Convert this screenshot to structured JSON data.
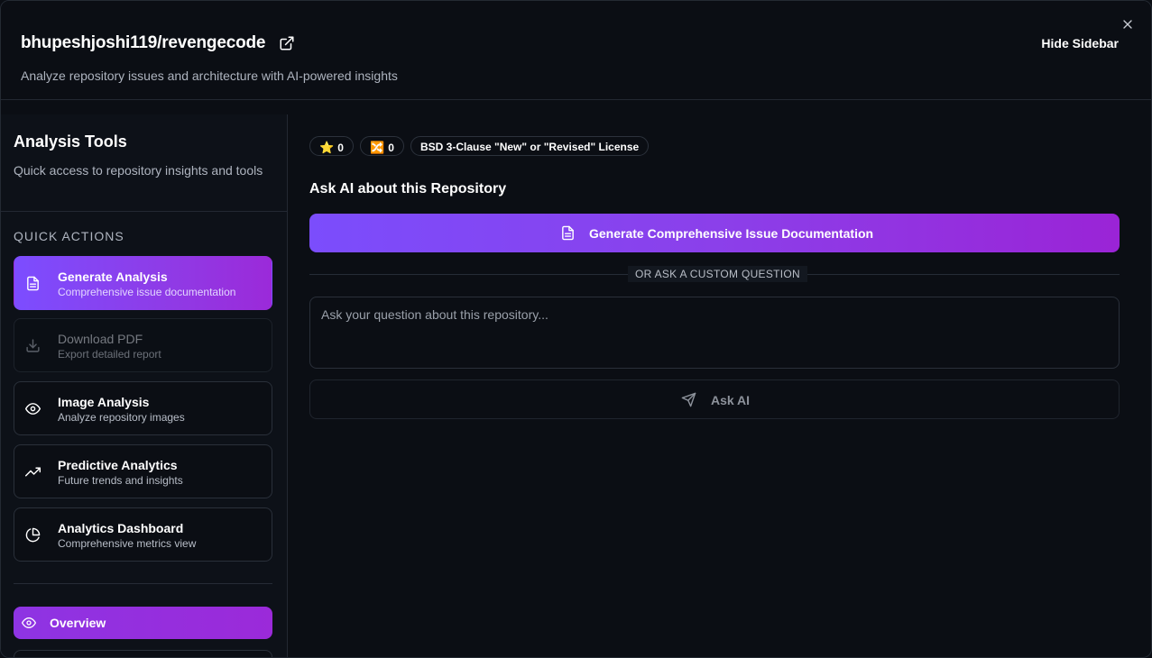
{
  "header": {
    "title": "bhupeshjoshi119/revengecode",
    "subtitle": "Analyze repository issues and architecture with AI-powered insights",
    "hide_sidebar_label": "Hide Sidebar"
  },
  "sidebar": {
    "title": "Analysis Tools",
    "description": "Quick access to repository insights and tools",
    "quick_actions_label": "QUICK ACTIONS",
    "items": [
      {
        "label": "Generate Analysis",
        "sublabel": "Comprehensive issue documentation",
        "icon": "document-icon",
        "state": "active"
      },
      {
        "label": "Download PDF",
        "sublabel": "Export detailed report",
        "icon": "download-icon",
        "state": "disabled"
      },
      {
        "label": "Image Analysis",
        "sublabel": "Analyze repository images",
        "icon": "eye-icon",
        "state": "normal"
      },
      {
        "label": "Predictive Analytics",
        "sublabel": "Future trends and insights",
        "icon": "trending-up-icon",
        "state": "normal"
      },
      {
        "label": "Analytics Dashboard",
        "sublabel": "Comprehensive metrics view",
        "icon": "pie-chart-icon",
        "state": "normal"
      }
    ],
    "nav": {
      "overview_label": "Overview"
    }
  },
  "main": {
    "badges": {
      "stars": {
        "icon": "⭐",
        "value": "0"
      },
      "forks": {
        "icon": "🔀",
        "value": "0"
      },
      "license": "BSD 3-Clause \"New\" or \"Revised\" License"
    },
    "ask_title": "Ask AI about this Repository",
    "generate_button_label": "Generate Comprehensive Issue Documentation",
    "divider_label": "OR ASK A CUSTOM QUESTION",
    "question_placeholder": "Ask your question about this repository...",
    "question_value": "",
    "ask_button_label": "Ask AI"
  },
  "colors": {
    "background": "#0b0e14",
    "accent_start": "#7b4dfc",
    "accent_end": "#9a24d6",
    "border": "#2a303a"
  }
}
